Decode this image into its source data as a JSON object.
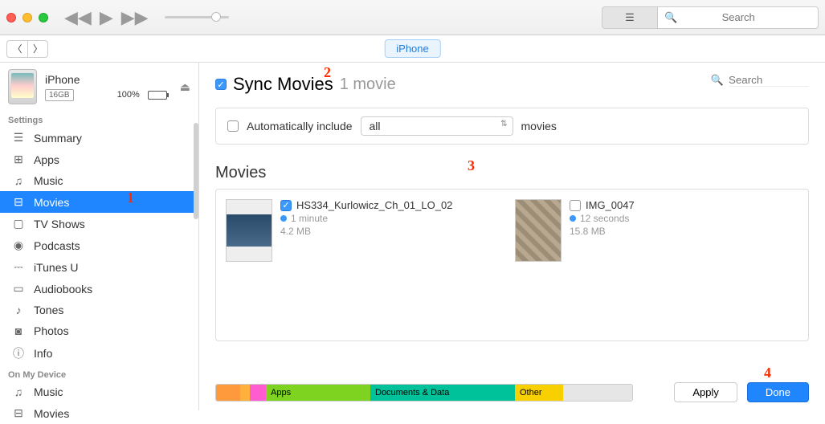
{
  "titlebar": {
    "search_placeholder": "Search"
  },
  "secondbar": {
    "breadcrumb": "iPhone"
  },
  "sidebar": {
    "device": {
      "name": "iPhone",
      "capacity": "16GB",
      "battery_text": "100%"
    },
    "sections": {
      "settings_label": "Settings",
      "on_device_label": "On My Device"
    },
    "settings": [
      {
        "icon": "summary-icon",
        "glyph": "☰",
        "label": "Summary"
      },
      {
        "icon": "apps-icon",
        "glyph": "⊞",
        "label": "Apps"
      },
      {
        "icon": "music-icon",
        "glyph": "♫",
        "label": "Music"
      },
      {
        "icon": "movies-icon",
        "glyph": "⊟",
        "label": "Movies"
      },
      {
        "icon": "tvshows-icon",
        "glyph": "▢",
        "label": "TV Shows"
      },
      {
        "icon": "podcasts-icon",
        "glyph": "◉",
        "label": "Podcasts"
      },
      {
        "icon": "itunesu-icon",
        "glyph": "⎓",
        "label": "iTunes U"
      },
      {
        "icon": "audiobooks-icon",
        "glyph": "▭",
        "label": "Audiobooks"
      },
      {
        "icon": "tones-icon",
        "glyph": "♪",
        "label": "Tones"
      },
      {
        "icon": "photos-icon",
        "glyph": "◙",
        "label": "Photos"
      },
      {
        "icon": "info-icon",
        "glyph": "ⓘ",
        "label": "Info"
      }
    ],
    "on_device": [
      {
        "icon": "music-icon",
        "glyph": "♫",
        "label": "Music"
      },
      {
        "icon": "movies-icon",
        "glyph": "⊟",
        "label": "Movies"
      }
    ]
  },
  "content": {
    "sync_label": "Sync Movies",
    "sync_count": "1 movie",
    "auto_include_label": "Automatically include",
    "auto_include_select": "all",
    "auto_include_suffix": "movies",
    "search_placeholder": "Search",
    "section_label": "Movies",
    "movies": [
      {
        "title": "HS334_Kurlowicz_Ch_01_LO_02",
        "duration": "1 minute",
        "size": "4.2 MB",
        "checked": true
      },
      {
        "title": "IMG_0047",
        "duration": "12 seconds",
        "size": "15.8 MB",
        "checked": false
      }
    ]
  },
  "footer": {
    "segments": {
      "apps": "Apps",
      "docs": "Documents & Data",
      "other": "Other"
    },
    "apply": "Apply",
    "done": "Done"
  },
  "callouts": {
    "c1": "1",
    "c2": "2",
    "c3": "3",
    "c4": "4"
  }
}
